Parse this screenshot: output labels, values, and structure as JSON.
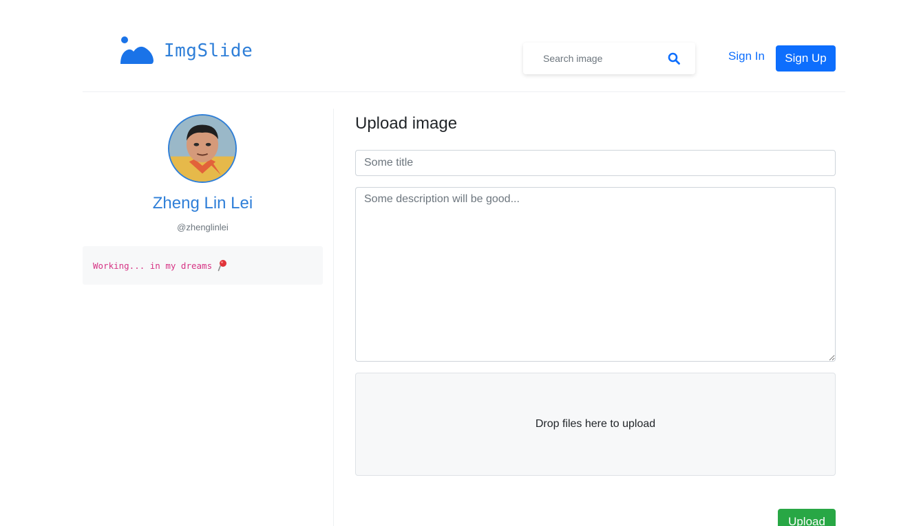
{
  "header": {
    "brand_name": "ImgSlide",
    "search": {
      "placeholder": "Search image"
    },
    "signin_label": "Sign In",
    "signup_label": "Sign Up"
  },
  "profile": {
    "name": "Zheng Lin Lei",
    "handle": "@zhenglinlei",
    "bio": "Working... in my dreams"
  },
  "upload": {
    "heading": "Upload image",
    "title_placeholder": "Some title",
    "description_placeholder": "Some description will be good...",
    "dropzone_text": "Drop files here to upload",
    "upload_label": "Upload"
  },
  "colors": {
    "primary": "#0d6efd",
    "brand": "#2f7fd8",
    "success": "#28a745",
    "bio_text": "#d63384"
  },
  "icons": {
    "brand": "mountain-logo-icon",
    "search": "search-icon",
    "bio": "pushpin-icon"
  }
}
